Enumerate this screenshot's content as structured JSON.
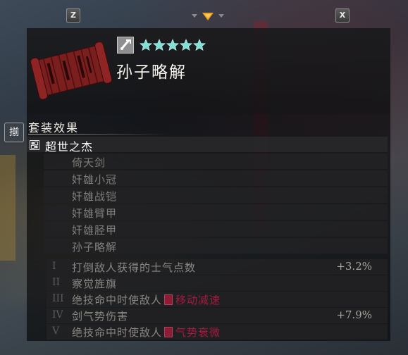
{
  "topbar": {
    "prev_key": "Z",
    "next_key": "X"
  },
  "item": {
    "name": "孙子略解",
    "type_icon": "fan-scroll-icon",
    "rarity_stars": 5
  },
  "side_tab": {
    "label": "揃"
  },
  "set_bonus": {
    "title": "套装效果",
    "set_name": "超世之杰",
    "pieces": [
      "倚天剑",
      "奸雄小冠",
      "奸雄战铠",
      "奸雄臂甲",
      "奸雄胫甲",
      "孙子略解"
    ],
    "effects": [
      {
        "numeral": "I",
        "text": "打倒敌人获得的士气点数",
        "value": "+3.2%"
      },
      {
        "numeral": "II",
        "text": "察觉旌旗",
        "value": ""
      },
      {
        "numeral": "III",
        "text": "绝技命中时使敌人",
        "debuff": "移动减速",
        "value": ""
      },
      {
        "numeral": "IV",
        "text": "剑气势伤害",
        "value": "+7.9%"
      },
      {
        "numeral": "V",
        "text": "绝技命中时使敌人",
        "debuff": "气势衰微",
        "value": ""
      }
    ]
  },
  "colors": {
    "star": "#7fe0d8",
    "debuff": "#a31b3f",
    "pager_active": "#f0a020"
  }
}
